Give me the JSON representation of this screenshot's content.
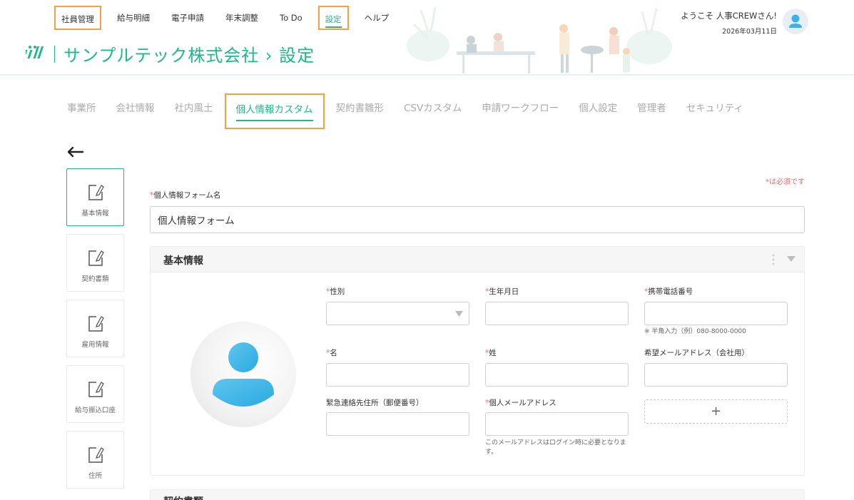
{
  "topnav": {
    "items": [
      {
        "label": "社員管理"
      },
      {
        "label": "給与明細"
      },
      {
        "label": "電子申請"
      },
      {
        "label": "年末調整"
      },
      {
        "label": "To Do"
      },
      {
        "label": "設定"
      },
      {
        "label": "ヘルプ"
      }
    ]
  },
  "brand": {
    "title": "サンプルテック株式会社 › 設定"
  },
  "user": {
    "greeting": "ようこそ 人事CREWさん!",
    "date": "2026年03月11日"
  },
  "settings_tabs": [
    {
      "label": "事業所"
    },
    {
      "label": "会社情報"
    },
    {
      "label": "社内風土"
    },
    {
      "label": "個人情報カスタム"
    },
    {
      "label": "契約書雛形"
    },
    {
      "label": "CSVカスタム"
    },
    {
      "label": "申請ワークフロー"
    },
    {
      "label": "個人設定"
    },
    {
      "label": "管理者"
    },
    {
      "label": "セキュリティ"
    }
  ],
  "leftnav": [
    {
      "label": "基本情報"
    },
    {
      "label": "契約書類"
    },
    {
      "label": "雇用情報"
    },
    {
      "label": "給与振込口座"
    },
    {
      "label": "住所"
    }
  ],
  "form": {
    "required_note": "*は必須です",
    "name_label": "個人情報フォーム名",
    "name_value": "個人情報フォーム",
    "section_title": "基本情報",
    "next_section_title": "契約書類",
    "fields": {
      "gender": "性別",
      "birthdate": "生年月日",
      "mobile": "携帯電話番号",
      "mobile_hint": "※ 半角入力（例）080-8000-0000",
      "first_name": "名",
      "last_name": "姓",
      "desired_email": "希望メールアドレス（会社用）",
      "emergency_address": "緊急連絡先住所（郵便番号）",
      "personal_email": "個人メールアドレス",
      "personal_email_hint": "このメールアドレスはログイン時に必要となります。"
    },
    "add_label": "+"
  },
  "colors": {
    "accent": "#1eb88a",
    "highlight": "#f5a142",
    "required": "#f06a6a",
    "avatar_blue": "#3ab3e6"
  },
  "icons": [
    "edit-note-icon",
    "back-arrow-icon",
    "user-avatar-icon",
    "kebab-menu-icon",
    "chevron-down-icon"
  ]
}
